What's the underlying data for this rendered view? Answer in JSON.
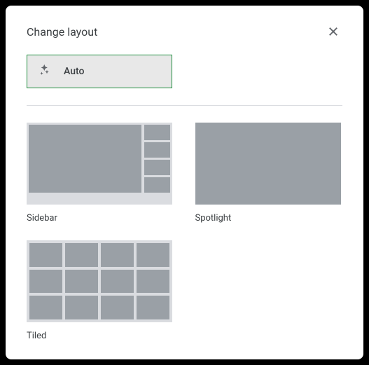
{
  "dialog": {
    "title": "Change layout"
  },
  "auto": {
    "label": "Auto"
  },
  "layouts": {
    "sidebar": {
      "label": "Sidebar"
    },
    "spotlight": {
      "label": "Spotlight"
    },
    "tiled": {
      "label": "Tiled"
    }
  }
}
